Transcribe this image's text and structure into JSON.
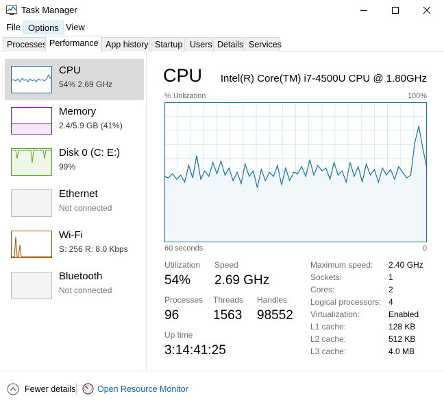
{
  "window": {
    "title": "Task Manager"
  },
  "icons": {
    "app": "task-manager-icon",
    "minimize": "minimize-icon",
    "maximize": "maximize-icon",
    "close": "close-icon",
    "fewer_details": "chevron-up-circle-icon",
    "resource_monitor": "resource-monitor-icon"
  },
  "menu": [
    {
      "label": "File",
      "active": false
    },
    {
      "label": "Options",
      "active": true
    },
    {
      "label": "View",
      "active": false
    }
  ],
  "tabs": [
    {
      "label": "Processes",
      "selected": false
    },
    {
      "label": "Performance",
      "selected": true
    },
    {
      "label": "App history",
      "selected": false
    },
    {
      "label": "Startup",
      "selected": false
    },
    {
      "label": "Users",
      "selected": false
    },
    {
      "label": "Details",
      "selected": false
    },
    {
      "label": "Services",
      "selected": false
    }
  ],
  "sidebar": [
    {
      "name": "CPU",
      "sub": "54%  2.69 GHz",
      "selected": true,
      "color": "#1172ab"
    },
    {
      "name": "Memory",
      "sub": "2.4/5.9 GB (41%)",
      "selected": false,
      "color": "#8b12ae"
    },
    {
      "name": "Disk 0 (C: E:)",
      "sub": "99%",
      "selected": false,
      "color": "#4da60c"
    },
    {
      "name": "Ethernet",
      "sub": "Not connected",
      "selected": false,
      "color": "#bbbbbb"
    },
    {
      "name": "Wi-Fi",
      "sub": "S: 256  R: 8.0 Kbps",
      "selected": false,
      "color": "#a74f01"
    },
    {
      "name": "Bluetooth",
      "sub": "Not connected",
      "selected": false,
      "color": "#bbbbbb"
    }
  ],
  "cpu": {
    "heading": "CPU",
    "model": "Intel(R) Core(TM) i7-4500U CPU @ 1.80GHz",
    "graph": {
      "y_label": "% Utilization",
      "y_max_label": "100%",
      "x_left_label": "60 seconds",
      "x_right_label": "0",
      "ylim": [
        0,
        100
      ],
      "line_color": "#1172ab",
      "fill_color": "#f1f6fb",
      "grid_color": "#d9eaf4",
      "values": [
        47,
        46,
        49,
        45,
        48,
        43,
        55,
        46,
        62,
        45,
        51,
        47,
        57,
        49,
        58,
        48,
        53,
        44,
        50,
        42,
        56,
        47,
        51,
        39,
        52,
        44,
        50,
        47,
        55,
        41,
        53,
        44,
        50,
        49,
        54,
        47,
        59,
        48,
        55,
        51,
        53,
        45,
        57,
        48,
        51,
        43,
        57,
        47,
        54,
        43,
        56,
        48,
        52,
        43,
        53,
        48,
        52,
        45,
        54,
        50,
        46,
        48,
        71,
        83,
        67,
        53
      ]
    },
    "stats": {
      "utilization": {
        "label": "Utilization",
        "value": "54%"
      },
      "speed": {
        "label": "Speed",
        "value": "2.69 GHz"
      },
      "processes": {
        "label": "Processes",
        "value": "96"
      },
      "threads": {
        "label": "Threads",
        "value": "1563"
      },
      "handles": {
        "label": "Handles",
        "value": "98552"
      },
      "uptime": {
        "label": "Up time",
        "value": "3:14:41:25"
      }
    },
    "specs": [
      {
        "key": "Maximum speed:",
        "value": "2.40 GHz"
      },
      {
        "key": "Sockets:",
        "value": "1"
      },
      {
        "key": "Cores:",
        "value": "2"
      },
      {
        "key": "Logical processors:",
        "value": "4"
      },
      {
        "key": "Virtualization:",
        "value": "Enabled"
      },
      {
        "key": "L1 cache:",
        "value": "128 KB"
      },
      {
        "key": "L2 cache:",
        "value": "512 KB"
      },
      {
        "key": "L3 cache:",
        "value": "4.0 MB"
      }
    ]
  },
  "footer": {
    "fewer_details": "Fewer details",
    "open_resource_monitor": "Open Resource Monitor"
  }
}
